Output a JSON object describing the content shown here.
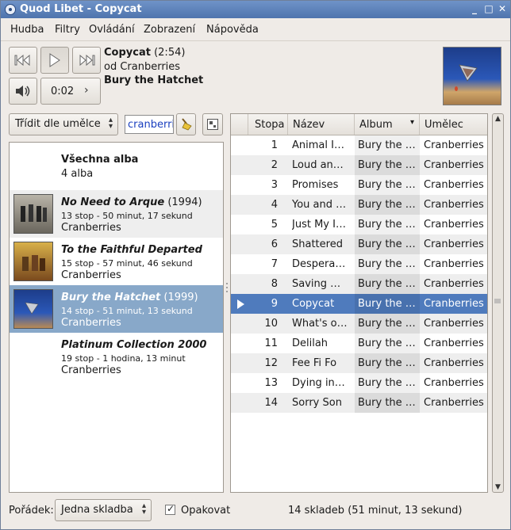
{
  "window": {
    "title": "Quod Libet - Copycat",
    "buttons": {
      "minimize": "_",
      "maximize": "□",
      "close": "✕"
    }
  },
  "menu": [
    {
      "label": "Hudba"
    },
    {
      "label": "Filtry"
    },
    {
      "label": "Ovládání"
    },
    {
      "label": "Zobrazení"
    },
    {
      "label": "Nápověda"
    }
  ],
  "player": {
    "title": "Copycat",
    "length": "(2:54)",
    "artist_line": "od Cranberries",
    "album": "Bury the Hatchet",
    "position": "0:02"
  },
  "browser": {
    "sort_label": "Třídit dle umělce",
    "search_value": "cranberri"
  },
  "albums": {
    "all": {
      "title": "Všechna alba",
      "count": "4 alba"
    },
    "items": [
      {
        "title": "No Need to Arque",
        "year": "(1994)",
        "details": "13 stop - 50 minut, 17 sekund",
        "artist": "Cranberries"
      },
      {
        "title": "To the Faithful Departed",
        "year": "",
        "details": "15 stop - 57 minut, 46 sekund",
        "artist": "Cranberries"
      },
      {
        "title": "Bury the Hatchet",
        "year": "(1999)",
        "details": "14 stop - 51 minut, 13 sekund",
        "artist": "Cranberries"
      },
      {
        "title": "Platinum Collection 2000",
        "year": "",
        "details": "19 stop - 1 hodina, 13 minut",
        "artist": "Cranberries"
      }
    ]
  },
  "tracks": {
    "columns": {
      "number": "Stopa",
      "title": "Název",
      "album": "Album",
      "artist": "Umělec"
    },
    "rows": [
      {
        "number": "1",
        "title": "Animal Instinct",
        "album": "Bury the Hatchet",
        "artist": "Cranberries"
      },
      {
        "number": "2",
        "title": "Loud and Clear",
        "album": "Bury the Hatchet",
        "artist": "Cranberries"
      },
      {
        "number": "3",
        "title": "Promises",
        "album": "Bury the Hatchet",
        "artist": "Cranberries"
      },
      {
        "number": "4",
        "title": "You and Me",
        "album": "Bury the Hatchet",
        "artist": "Cranberries"
      },
      {
        "number": "5",
        "title": "Just My Imagination",
        "album": "Bury the Hatchet",
        "artist": "Cranberries"
      },
      {
        "number": "6",
        "title": "Shattered",
        "album": "Bury the Hatchet",
        "artist": "Cranberries"
      },
      {
        "number": "7",
        "title": "Desperate Andy",
        "album": "Bury the Hatchet",
        "artist": "Cranberries"
      },
      {
        "number": "8",
        "title": "Saving Grace",
        "album": "Bury the Hatchet",
        "artist": "Cranberries"
      },
      {
        "number": "9",
        "title": "Copycat",
        "album": "Bury the Hatchet",
        "artist": "Cranberries"
      },
      {
        "number": "10",
        "title": "What's on My Mind",
        "album": "Bury the Hatchet",
        "artist": "Cranberries"
      },
      {
        "number": "11",
        "title": "Delilah",
        "album": "Bury the Hatchet",
        "artist": "Cranberries"
      },
      {
        "number": "12",
        "title": "Fee Fi Fo",
        "album": "Bury the Hatchet",
        "artist": "Cranberries"
      },
      {
        "number": "13",
        "title": "Dying in the Sun",
        "album": "Bury the Hatchet",
        "artist": "Cranberries"
      },
      {
        "number": "14",
        "title": "Sorry Son",
        "album": "Bury the Hatchet",
        "artist": "Cranberries"
      }
    ]
  },
  "footer": {
    "order_label": "Pořádek:",
    "order_value": "Jedna skladba",
    "repeat_label": "Opakovat",
    "repeat_checked": true,
    "summary": "14 skladeb (51 minut, 13 sekund)"
  },
  "colors": {
    "selection": "#4f7bbd",
    "album_selection": "#88a8c9",
    "title_bar": "#5a7fb8",
    "search_text": "#1a3fbf"
  },
  "icons": [
    "quodlibet-icon",
    "previous-icon",
    "play-icon",
    "next-icon",
    "volume-icon",
    "chevron-right-icon",
    "clear-broom-icon",
    "album-view-icon",
    "play-marker-icon"
  ]
}
